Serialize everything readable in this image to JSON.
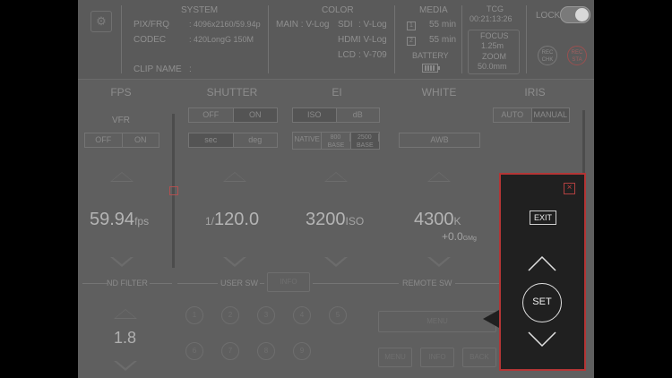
{
  "topbar": {
    "system": {
      "title": "SYSTEM",
      "pix_frq_label": "PIX/FRQ",
      "pix_frq_value": ": 4096x2160/59.94p",
      "codec_label": "CODEC",
      "codec_value": ": 420LongG 150M",
      "clip_name_label": "CLIP NAME",
      "clip_name_value": ":"
    },
    "color": {
      "title": "COLOR",
      "main_label": "MAIN : V-Log",
      "sdi_label": "SDI",
      "sdi_value": ": V-Log",
      "hdmi_label": "HDMI",
      "hdmi_value": ": V-Log",
      "lcd_label": "LCD",
      "lcd_value": ": V-709"
    },
    "media": {
      "title": "MEDIA",
      "slot1": "1",
      "slot1_value": "55 min",
      "slot2": "2",
      "slot2_value": "55 min",
      "battery_label": "BATTERY"
    },
    "tcg": {
      "title": "TCG",
      "value": "00:21:13:26",
      "focus_label": "FOCUS",
      "focus_value": "1.25m",
      "zoom_label": "ZOOM",
      "zoom_value": "50.0mm"
    },
    "lock_label": "LOCK",
    "rec_check_label": "REC CHK",
    "rec_label": "REC STA"
  },
  "sections": {
    "fps": "FPS",
    "shutter": "SHUTTER",
    "ei": "EI",
    "white": "WHITE",
    "iris": "IRIS"
  },
  "fps": {
    "vfr_label": "VFR",
    "vfr_off": "OFF",
    "vfr_on": "ON",
    "value": "59.94",
    "unit": "fps"
  },
  "shutter": {
    "off": "OFF",
    "on": "ON",
    "sec": "sec",
    "deg": "deg",
    "prefix": "1/",
    "value": "120.0"
  },
  "ei": {
    "iso": "ISO",
    "db": "dB",
    "native": "NATIVE",
    "base800_a": "800",
    "base800_b": "BASE",
    "base2500_a": "2500",
    "base2500_b": "BASE",
    "value": "3200",
    "unit": "ISO"
  },
  "white": {
    "awb": "AWB",
    "value": "4300",
    "unit": "K",
    "sub_value": "+0.0",
    "sub_unit": "GMg"
  },
  "iris": {
    "auto": "AUTO",
    "manual": "MANUAL"
  },
  "bottom": {
    "nd_filter_label": "ND FILTER",
    "nd_value": "1.8",
    "user_sw_label": "USER SW",
    "info_label": "INFO",
    "remote_sw_label": "REMOTE SW",
    "user_buttons": [
      "1",
      "2",
      "3",
      "4",
      "5",
      "6",
      "7",
      "8",
      "9"
    ],
    "menu_label": "MENU",
    "sub_buttons": [
      "MENU",
      "INFO",
      "BACK"
    ]
  },
  "panel": {
    "close": "×",
    "exit": "EXIT",
    "set": "SET"
  }
}
